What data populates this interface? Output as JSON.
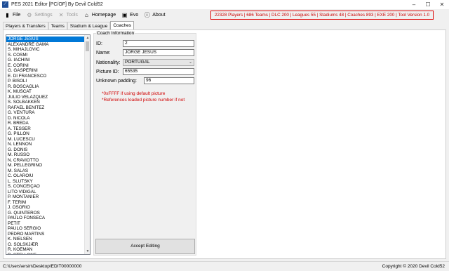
{
  "window": {
    "title": "PES 2021 Editor [PC/OF] By Devil Cold52",
    "min": "–",
    "max": "☐",
    "close": "✕"
  },
  "menu": [
    {
      "label": "File",
      "icon": "file-icon",
      "glyph": "▮",
      "disabled": false
    },
    {
      "label": "Settings",
      "icon": "gear-icon",
      "glyph": "⚙",
      "disabled": true
    },
    {
      "label": "Tools",
      "icon": "wrench-icon",
      "glyph": "✕",
      "disabled": true
    },
    {
      "label": "Homepage",
      "icon": "home-icon",
      "glyph": "⌂",
      "disabled": false
    },
    {
      "label": "Evo",
      "icon": "evo-icon",
      "glyph": "▣",
      "disabled": false
    },
    {
      "label": "About",
      "icon": "info-icon",
      "glyph": "ⓘ",
      "disabled": false
    }
  ],
  "info_bar": "22328 Players | 686 Teams | DLC 200 | Leagues 55 | Stadiums 48 | Coaches 893 | EXE 200 | Tool Version 1.0",
  "tabs": [
    {
      "label": "Players & Transfers",
      "active": false
    },
    {
      "label": "Teams",
      "active": false
    },
    {
      "label": "Stadium & League",
      "active": false
    },
    {
      "label": "Coaches",
      "active": true
    }
  ],
  "coach_list": [
    "JORGE JESUS",
    "ALEXANDRE GAMA",
    "S. MIHAJLOVIĆ",
    "S. COSMI",
    "G. IACHINI",
    "E. CORINI",
    "G. GASPERINI",
    "E. DI FRANCESCO",
    "P. BISOLI",
    "R. BOSCAGLIA",
    "K. MUSCAT",
    "JULIO VELÁZQUEZ",
    "S. SOLBAKKEN",
    "RAFAEL BENÍTEZ",
    "G. VENTURA",
    "D. NICOLA",
    "R. BREDA",
    "A. TESSER",
    "G. PILLON",
    "M. LUCESCU",
    "N. LENNON",
    "G. DONIS",
    "M. RUSSO",
    "N. CRAVIOTTO",
    "M. PELLEGRINO",
    "M. SALAS",
    "C. OLĂROIU",
    "L. SLUTSKY",
    "S. CONCEIÇÃO",
    "LITO VIDIGAL",
    "P. MONTANIER",
    "F. TERIM",
    "J. OSORIO",
    "G. QUINTEROS",
    "PAULO FONSECA",
    "PETIT",
    "PAULO SÉRGIO",
    "PEDRO MARTINS",
    "K. NIELSEN",
    "O. SOLSKJÆR",
    "R. KOEMAN",
    "R. STELLONE"
  ],
  "selected_index": 0,
  "coach_info": {
    "legend": "Coach Information",
    "id_label": "ID:",
    "id_value": "2",
    "name_label": "Name:",
    "name_value": "JORGE JESUS",
    "nationality_label": "Nationality:",
    "nationality_value": "PORTUGAL",
    "picture_label": "Picture ID:",
    "picture_value": "65535",
    "padding_label": "Unknown padding:",
    "padding_value": "96",
    "note1": "*0xFFFF if using default picture",
    "note2": "*References loaded picture number if not"
  },
  "accept_button": "Accept Editing",
  "status": {
    "path": "C:\\Users\\ersin\\Desktop\\EDIT00000000",
    "copyright": "Copyright ©  2020 Devil Cold52"
  }
}
